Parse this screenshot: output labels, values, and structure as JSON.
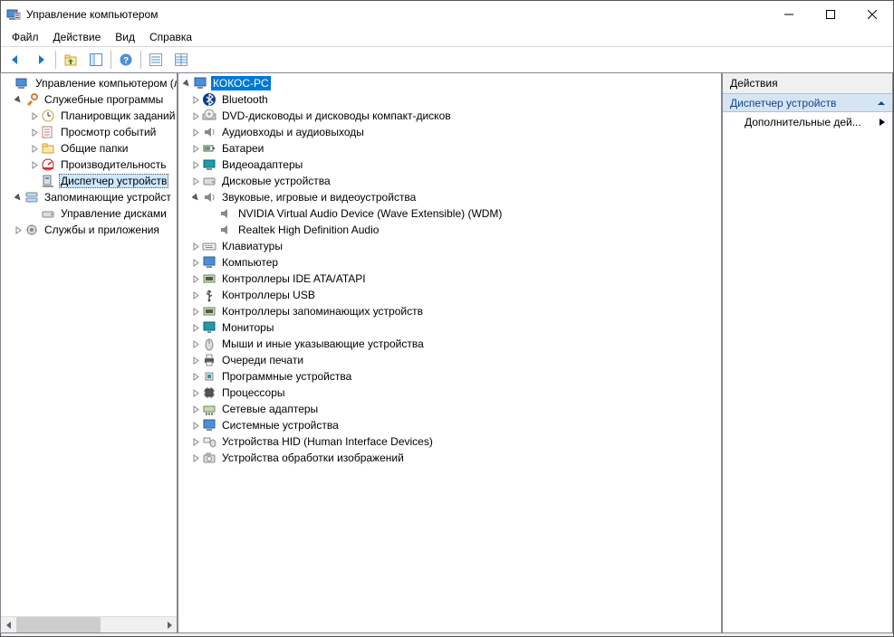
{
  "window": {
    "title": "Управление компьютером"
  },
  "menu": {
    "file": "Файл",
    "action": "Действие",
    "view": "Вид",
    "help": "Справка"
  },
  "leftTree": {
    "root": "Управление компьютером (л",
    "sys": "Служебные программы",
    "sched": "Планировщик заданий",
    "event": "Просмотр событий",
    "shared": "Общие папки",
    "perf": "Производительность",
    "devmgr": "Диспетчер устройств",
    "storage": "Запоминающие устройст",
    "diskmgmt": "Управление дисками",
    "services": "Службы и приложения"
  },
  "devTree": {
    "root": "КОКОС-PC",
    "bluetooth": "Bluetooth",
    "dvd": "DVD-дисководы и дисководы компакт-дисков",
    "audioio": "Аудиовходы и аудиовыходы",
    "battery": "Батареи",
    "video": "Видеоадаптеры",
    "disk": "Дисковые устройства",
    "sound": "Звуковые, игровые и видеоустройства",
    "sound_child1": "NVIDIA Virtual Audio Device (Wave Extensible) (WDM)",
    "sound_child2": "Realtek High Definition Audio",
    "keyboard": "Клавиатуры",
    "computer": "Компьютер",
    "ide": "Контроллеры IDE ATA/ATAPI",
    "usb": "Контроллеры USB",
    "storagectl": "Контроллеры запоминающих устройств",
    "monitor": "Мониторы",
    "mouse": "Мыши и иные указывающие устройства",
    "printq": "Очереди печати",
    "software": "Программные устройства",
    "cpu": "Процессоры",
    "net": "Сетевые адаптеры",
    "sysdev": "Системные устройства",
    "hid": "Устройства HID (Human Interface Devices)",
    "imaging": "Устройства обработки изображений"
  },
  "actions": {
    "header": "Действия",
    "sub": "Диспетчер устройств",
    "more": "Дополнительные дей..."
  }
}
